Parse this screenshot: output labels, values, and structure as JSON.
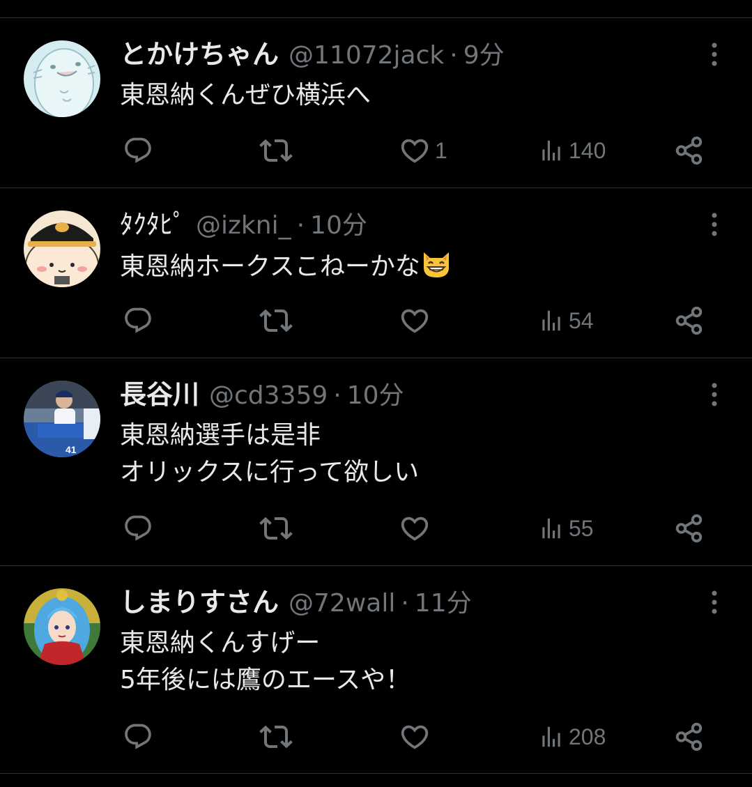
{
  "tweets": [
    {
      "display_name": "とかけちゃん",
      "handle": "@11072jack",
      "separator": "·",
      "time": "9分",
      "lines": [
        "東恩納くんぜひ横浜へ"
      ],
      "likes": "1",
      "views": "140",
      "avatar_icon": "cartoon-creature-avatar"
    },
    {
      "display_name": "ﾀｸﾀﾋﾟ",
      "handle": "@izkni_",
      "separator": "·",
      "time": "10分",
      "lines": [
        "東恩納ホークスこねーかな"
      ],
      "emoji": "grinning-cat-emoji",
      "likes": "",
      "views": "54",
      "avatar_icon": "cartoon-character-with-cap-avatar"
    },
    {
      "display_name": "長谷川",
      "handle": "@cd3359",
      "separator": "·",
      "time": "10分",
      "lines": [
        "東恩納選手は是非",
        "オリックスに行って欲しい"
      ],
      "likes": "",
      "views": "55",
      "avatar_icon": "baseball-photo-avatar"
    },
    {
      "display_name": "しまりすさん",
      "handle": "@72wall",
      "separator": "·",
      "time": "11分",
      "lines": [
        "東恩納くんすげー",
        "5年後には鷹のエースや！"
      ],
      "likes": "",
      "views": "208",
      "avatar_icon": "anime-girl-avatar"
    }
  ],
  "icons": {
    "reply": "reply-icon",
    "retweet": "retweet-icon",
    "like": "heart-icon",
    "views": "views-icon",
    "share": "share-icon",
    "more": "more-icon"
  },
  "colors": {
    "background": "#000000",
    "text_primary": "#e7e9ea",
    "text_secondary": "#71767b",
    "divider": "#2f3336"
  }
}
